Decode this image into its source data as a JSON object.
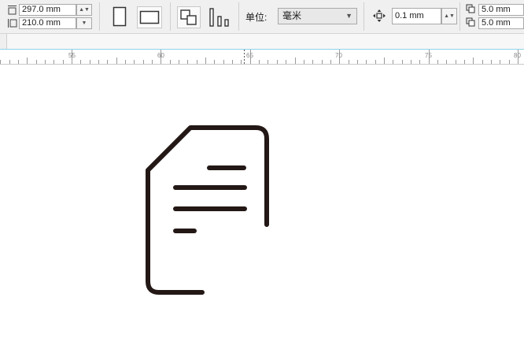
{
  "toolbar": {
    "height_value": "297.0 mm",
    "width_value": "210.0 mm",
    "unit_label": "单位:",
    "unit_value": "毫米",
    "nudge_value": "0.1 mm",
    "dup_x_value": "5.0 mm",
    "dup_y_value": "5.0 mm",
    "icons": {
      "page_height": "page-height-icon",
      "page_width": "page-width-icon",
      "portrait": "portrait-page-icon",
      "landscape": "landscape-page-icon",
      "all_pages": "all-pages-icon",
      "current_page": "current-page-icon",
      "nudge": "nudge-move-icon",
      "dup_x": "duplicate-x-icon",
      "dup_y": "duplicate-y-icon"
    }
  },
  "ruler": {
    "labels": [
      "55",
      "60",
      "65",
      "70",
      "75",
      "80"
    ]
  },
  "canvas": {
    "artwork": "document-icon",
    "stroke_color": "#231815"
  }
}
